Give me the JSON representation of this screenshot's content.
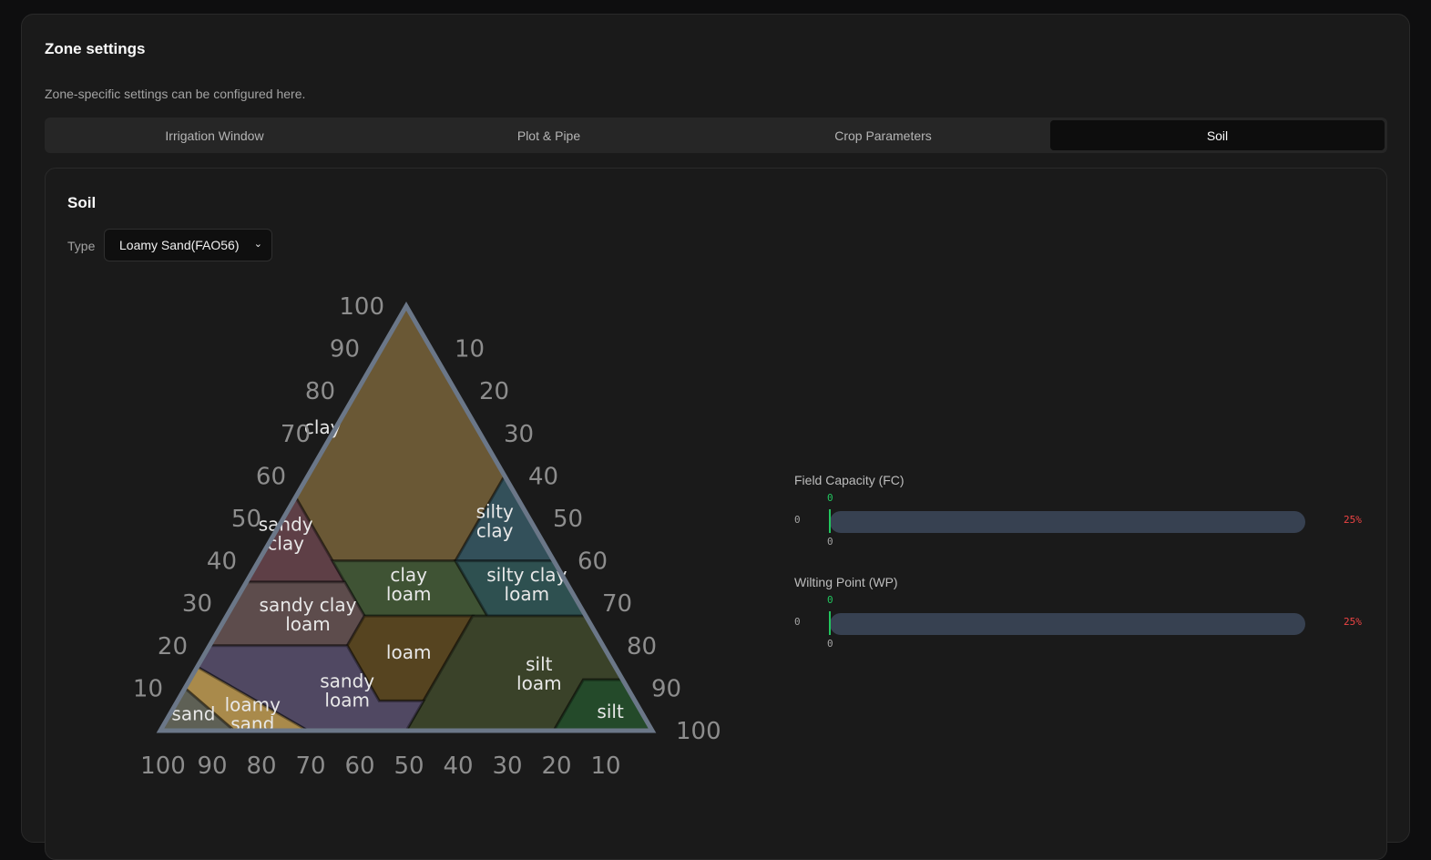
{
  "header": {
    "title": "Zone settings",
    "description": "Zone-specific settings can be configured here."
  },
  "tabs": [
    {
      "label": "Irrigation Window"
    },
    {
      "label": "Plot & Pipe"
    },
    {
      "label": "Crop Parameters"
    },
    {
      "label": "Soil",
      "active": true
    }
  ],
  "soil": {
    "title": "Soil",
    "type_label": "Type",
    "type_value": "Loamy Sand(FAO56)"
  },
  "triangle": {
    "left_axis_labels": [
      "100",
      "90",
      "80",
      "70",
      "60",
      "50",
      "40",
      "30",
      "20",
      "10"
    ],
    "right_axis_labels": [
      "10",
      "20",
      "30",
      "40",
      "50",
      "60",
      "70",
      "80",
      "90",
      "100"
    ],
    "bottom_axis_labels": [
      "100",
      "90",
      "80",
      "70",
      "60",
      "50",
      "40",
      "30",
      "20",
      "10"
    ],
    "regions": [
      {
        "name": "clay",
        "label": [
          "clay"
        ],
        "color": "#6a5835",
        "points": [
          [
            0,
            100
          ],
          [
            45,
            55
          ],
          [
            45,
            40
          ],
          [
            20,
            40
          ],
          [
            0,
            60
          ]
        ]
      },
      {
        "name": "silty-clay",
        "label": [
          "silty",
          "clay"
        ],
        "color": "#33505a",
        "points": [
          [
            0,
            60
          ],
          [
            20,
            40
          ],
          [
            0,
            40
          ]
        ]
      },
      {
        "name": "sandy-clay",
        "label": [
          "sandy",
          "clay"
        ],
        "color": "#5e3f46",
        "points": [
          [
            45,
            55
          ],
          [
            65,
            35
          ],
          [
            45,
            35
          ]
        ]
      },
      {
        "name": "clay-loam",
        "label": [
          "clay",
          "loam"
        ],
        "color": "#3f5334",
        "points": [
          [
            20,
            40
          ],
          [
            45,
            40
          ],
          [
            45,
            27
          ],
          [
            20,
            27
          ]
        ]
      },
      {
        "name": "silty-clay-loam",
        "label": [
          "silty clay",
          "loam"
        ],
        "color": "#2e5050",
        "points": [
          [
            0,
            40
          ],
          [
            20,
            40
          ],
          [
            20,
            27
          ],
          [
            0,
            27
          ]
        ]
      },
      {
        "name": "sandy-clay-loam",
        "label": [
          "sandy clay",
          "loam"
        ],
        "color": "#5d4c4c",
        "points": [
          [
            45,
            35
          ],
          [
            65,
            35
          ],
          [
            80,
            20
          ],
          [
            52,
            20
          ],
          [
            45,
            27
          ]
        ]
      },
      {
        "name": "loam",
        "label": [
          "loam"
        ],
        "color": "#564420",
        "points": [
          [
            45,
            27
          ],
          [
            52,
            20
          ],
          [
            52,
            7
          ],
          [
            43,
            7
          ],
          [
            23,
            27
          ]
        ]
      },
      {
        "name": "silt-loam",
        "label": [
          "silt",
          "loam"
        ],
        "color": "#3a4229",
        "points": [
          [
            0,
            27
          ],
          [
            23,
            27
          ],
          [
            50,
            0
          ],
          [
            20,
            0
          ],
          [
            8,
            12
          ],
          [
            0,
            12
          ]
        ]
      },
      {
        "name": "silt",
        "label": [
          "silt"
        ],
        "color": "#244a2a",
        "points": [
          [
            0,
            12
          ],
          [
            8,
            12
          ],
          [
            20,
            0
          ],
          [
            0,
            0
          ]
        ]
      },
      {
        "name": "sandy-loam",
        "label": [
          "sandy",
          "loam"
        ],
        "color": "#504862",
        "points": [
          [
            50,
            0
          ],
          [
            43,
            7
          ],
          [
            52,
            7
          ],
          [
            52,
            20
          ],
          [
            80,
            20
          ],
          [
            85,
            15
          ],
          [
            70,
            0
          ]
        ]
      },
      {
        "name": "loamy-sand",
        "label": [
          "loamy",
          "sand"
        ],
        "color": "#a98a4b",
        "points": [
          [
            70,
            0
          ],
          [
            85,
            15
          ],
          [
            90,
            10
          ],
          [
            85,
            0
          ]
        ]
      },
      {
        "name": "sand",
        "label": [
          "sand"
        ],
        "color": "#5e6055",
        "points": [
          [
            85,
            0
          ],
          [
            90,
            10
          ],
          [
            100,
            0
          ]
        ]
      }
    ],
    "border_color": "#6b7788"
  },
  "meters": [
    {
      "label": "Field Capacity (FC)",
      "marker_value": "0",
      "min": "0",
      "below_value": "0",
      "max": "25%",
      "value": 0
    },
    {
      "label": "Wilting Point (WP)",
      "marker_value": "0",
      "min": "0",
      "below_value": "0",
      "max": "25%",
      "value": 0
    }
  ]
}
